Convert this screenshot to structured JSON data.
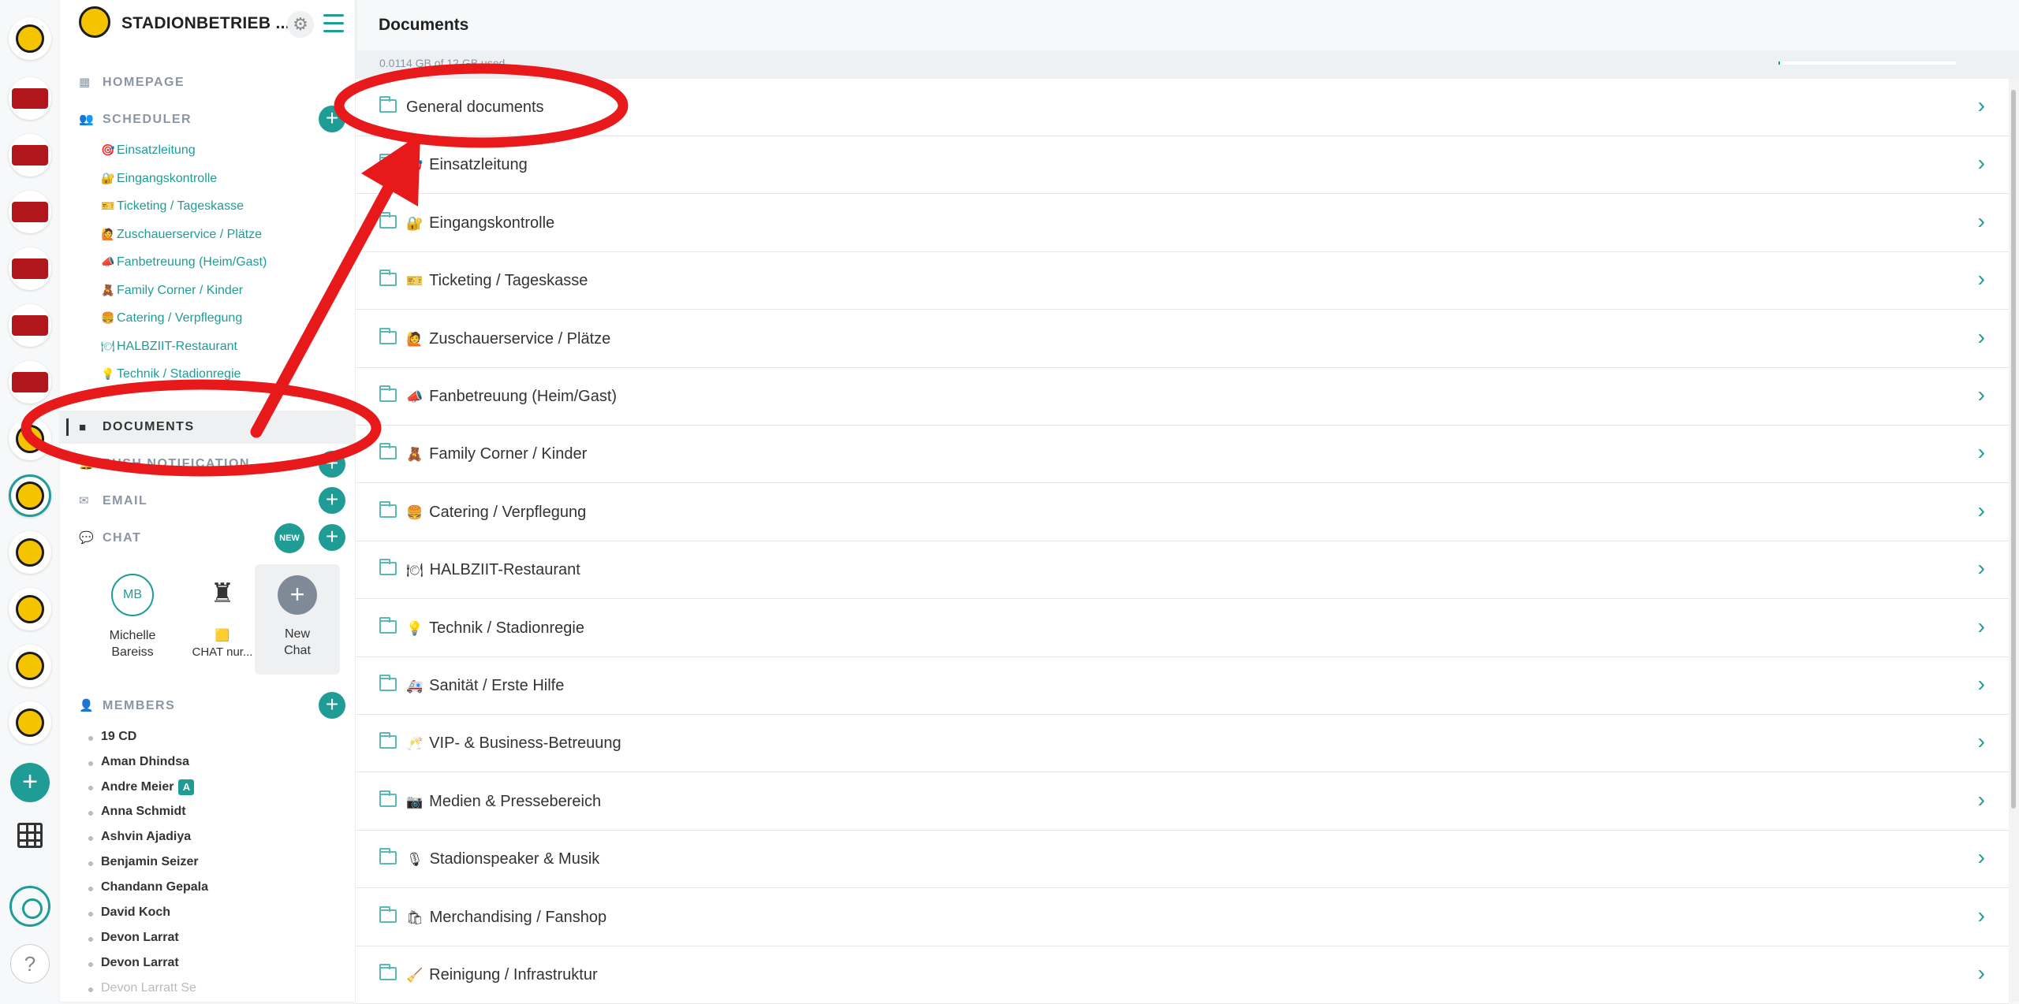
{
  "rail": {
    "workspaces": [
      "yellow",
      "red",
      "red",
      "red",
      "red",
      "red",
      "red",
      "yellow",
      "yellow",
      "yellow",
      "yellow",
      "yellow",
      "yellow"
    ],
    "add_icon": "plus-icon",
    "grid_icon": "grid-icon",
    "help_label": "?"
  },
  "sidebar": {
    "org_name": "STADIONBETRIEB ...",
    "homepage": "HOMEPAGE",
    "scheduler": "SCHEDULER",
    "scheduler_items": [
      {
        "emoji": "🎯",
        "label": "Einsatzleitung"
      },
      {
        "emoji": "🔐",
        "label": "Eingangskontrolle"
      },
      {
        "emoji": "🎫",
        "label": "Ticketing / Tageskasse"
      },
      {
        "emoji": "🙋",
        "label": "Zuschauerservice / Plätze"
      },
      {
        "emoji": "📣",
        "label": "Fanbetreuung (Heim/Gast)"
      },
      {
        "emoji": "🧸",
        "label": "Family Corner / Kinder"
      },
      {
        "emoji": "🍔",
        "label": "Catering / Verpflegung"
      },
      {
        "emoji": "🍽",
        "label": "HALBZIIT-Restaurant"
      },
      {
        "emoji": "💡",
        "label": "Technik / Stadionregie"
      }
    ],
    "documents": "DOCUMENTS",
    "push": "PUSH NOTIFICATION",
    "email": "EMAIL",
    "chat": "CHAT",
    "chat_new_badge": "NEW",
    "chats": [
      {
        "initials": "MB",
        "name_line1": "Michelle",
        "name_line2": "Bareiss"
      },
      {
        "initials": "♜",
        "name_line1": "🟨",
        "name_line2": "CHAT nur..."
      },
      {
        "initials": "+",
        "name_line1": "New",
        "name_line2": "Chat"
      }
    ],
    "members_title": "MEMBERS",
    "members": [
      "19 CD",
      "Aman Dhindsa",
      "Andre Meier",
      "Anna Schmidt",
      "Ashvin Ajadiya",
      "Benjamin Seizer",
      "Chandann Gepala",
      "David Koch",
      "Devon Larrat",
      "Devon Larrat",
      "Devon Larratt Se"
    ],
    "member_badge": "A"
  },
  "main": {
    "title": "Documents",
    "storage_text": "0.0114 GB of 12 GB used",
    "storage_fraction": 0.001,
    "folders": [
      {
        "emoji": "",
        "label": "General documents"
      },
      {
        "emoji": "🎯",
        "label": "Einsatzleitung"
      },
      {
        "emoji": "🔐",
        "label": "Eingangskontrolle"
      },
      {
        "emoji": "🎫",
        "label": "Ticketing / Tageskasse"
      },
      {
        "emoji": "🙋",
        "label": "Zuschauerservice / Plätze"
      },
      {
        "emoji": "📣",
        "label": "Fanbetreuung (Heim/Gast)"
      },
      {
        "emoji": "🧸",
        "label": "Family Corner / Kinder"
      },
      {
        "emoji": "🍔",
        "label": "Catering / Verpflegung"
      },
      {
        "emoji": "🍽",
        "label": "HALBZIIT-Restaurant"
      },
      {
        "emoji": "💡",
        "label": "Technik / Stadionregie"
      },
      {
        "emoji": "🚑",
        "label": "Sanität / Erste Hilfe"
      },
      {
        "emoji": "🥂",
        "label": "VIP- & Business-Betreuung"
      },
      {
        "emoji": "📷",
        "label": "Medien & Pressebereich"
      },
      {
        "emoji": "🎙",
        "label": "Stadionspeaker & Musik"
      },
      {
        "emoji": "🛍",
        "label": "Merchandising / Fanshop"
      },
      {
        "emoji": "🧹",
        "label": "Reinigung / Infrastruktur"
      }
    ]
  },
  "colors": {
    "accent": "#1f9c96",
    "annotation": "#e8191b"
  }
}
